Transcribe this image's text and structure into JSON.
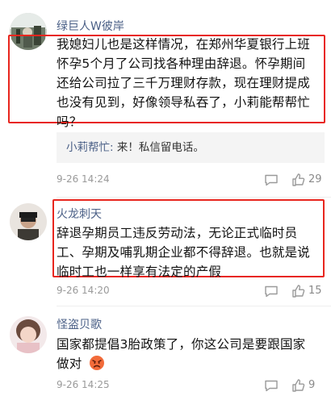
{
  "comments": [
    {
      "username": "绿巨人W彼岸",
      "lines": [
        "我媳妇儿也是这样情况，在郑州华夏银行上班",
        "怀孕5个月了公司找各种理由辞退。怀孕期间",
        "还给公司拉了三千万理财存款，现在理财提成",
        "也没有见到，好像领导私吞了，小莉能帮帮忙",
        "吗？"
      ],
      "reply": {
        "name": "小莉帮忙:",
        "text": " 来！私信留电话。"
      },
      "time": "9-26 14:24",
      "like_count": "29"
    },
    {
      "username": "火龙刺天",
      "lines": [
        "辞退孕期员工违反劳动法，无论正式临时员",
        "工、孕期及哺乳期企业都不得辞退。也就是说",
        "临时工也一样享有法定的产假"
      ],
      "time": "9-26 14:20",
      "like_count": "15"
    },
    {
      "username": "怪盗贝歌",
      "lines": [
        "国家都提倡3胎政策了，你这公司是要跟国家",
        "做对"
      ],
      "time": "9-26 14:25",
      "like_count": "9"
    }
  ],
  "icons": {
    "comment": "comment-icon",
    "like": "thumbs-up-icon",
    "emoji": "angry-face-emoji"
  },
  "colors": {
    "username": "#4a5f86",
    "highlight": "#e8261e",
    "meta": "#9a9a9a"
  }
}
